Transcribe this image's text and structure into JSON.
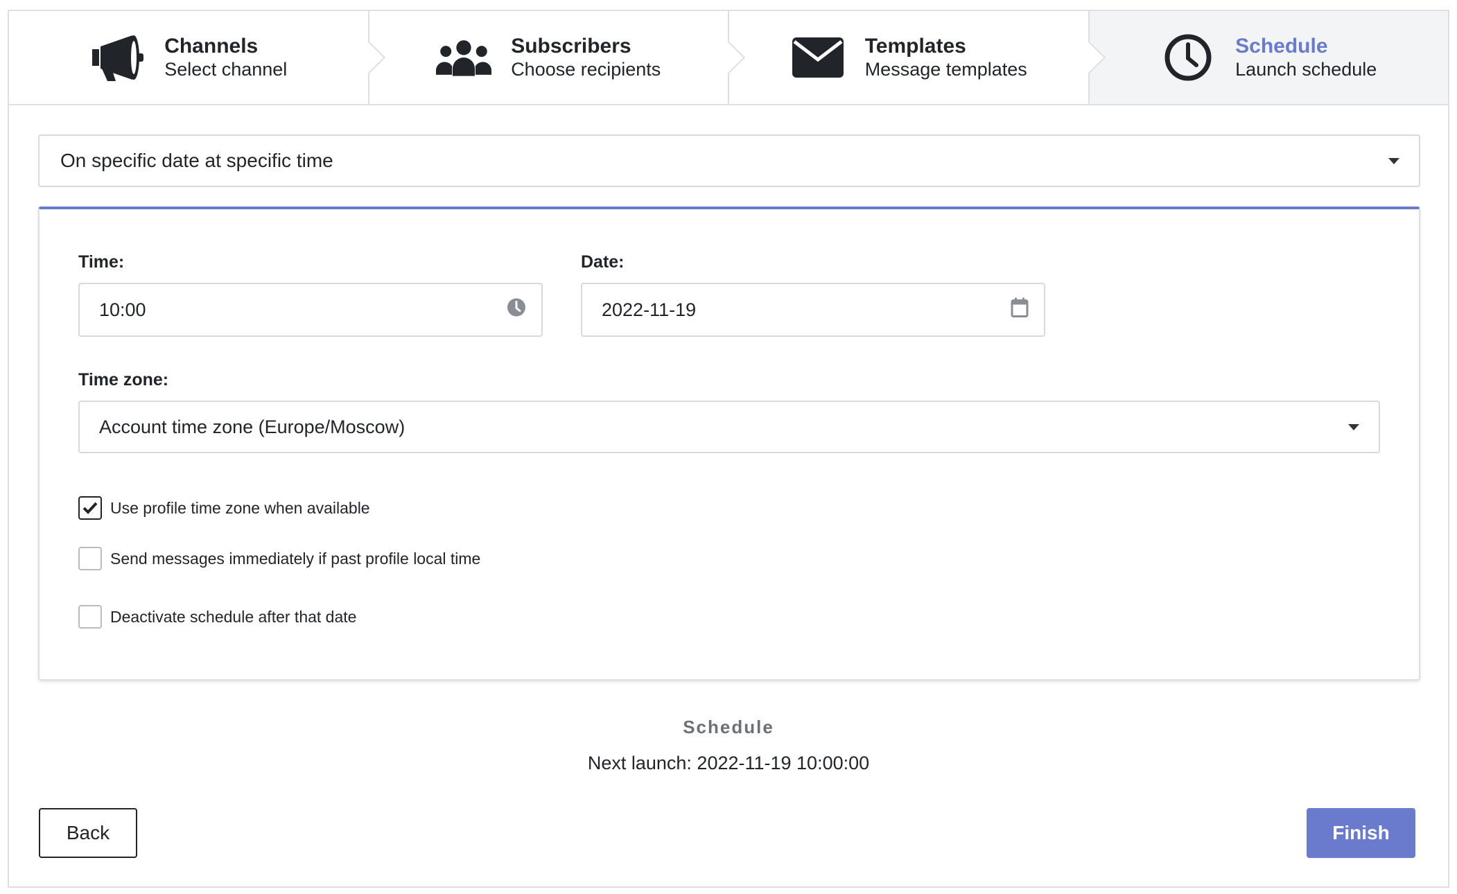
{
  "steps": [
    {
      "title": "Channels",
      "subtitle": "Select channel",
      "icon": "megaphone-icon"
    },
    {
      "title": "Subscribers",
      "subtitle": "Choose recipients",
      "icon": "users-icon"
    },
    {
      "title": "Templates",
      "subtitle": "Message templates",
      "icon": "envelope-icon"
    },
    {
      "title": "Schedule",
      "subtitle": "Launch schedule",
      "icon": "clock-icon",
      "active": true
    }
  ],
  "schedule_type": {
    "value": "On specific date at specific time"
  },
  "form": {
    "time_label": "Time:",
    "time_value": "10:00",
    "date_label": "Date:",
    "date_value": "2022-11-19",
    "timezone_label": "Time zone:",
    "timezone_value": "Account time zone (Europe/Moscow)",
    "options": [
      {
        "label": "Use profile time zone when available",
        "checked": true
      },
      {
        "label": "Send messages immediately if past profile local time",
        "checked": false
      },
      {
        "label": "Deactivate schedule after that date",
        "checked": false
      }
    ]
  },
  "summary": {
    "title": "Schedule",
    "next_launch": "Next launch: 2022-11-19 10:00:00"
  },
  "buttons": {
    "back": "Back",
    "finish": "Finish"
  },
  "colors": {
    "accent": "#6a7acc",
    "border": "#dcdfe3",
    "active_step_bg": "#f3f4f6",
    "text": "#212529"
  }
}
